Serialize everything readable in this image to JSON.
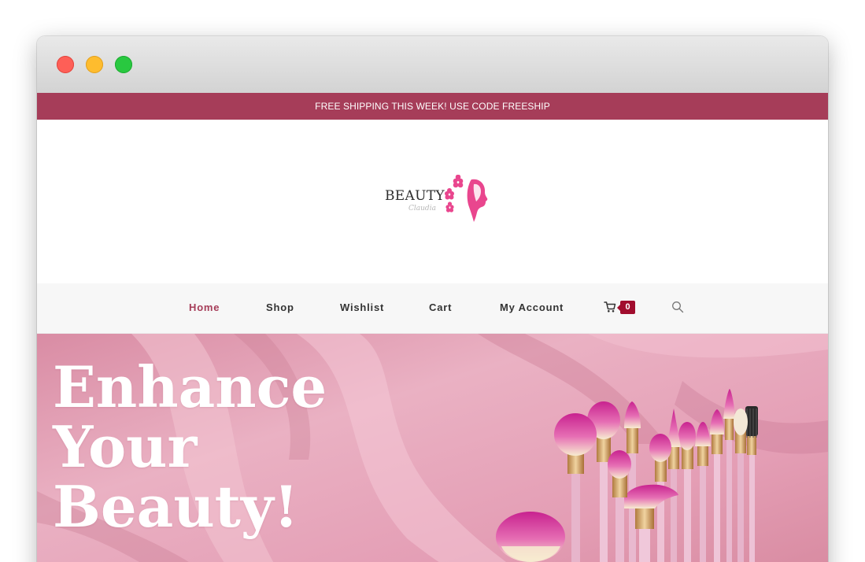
{
  "announcement": {
    "text": "FREE SHIPPING THIS WEEK! USE CODE FREESHIP"
  },
  "logo": {
    "word": "BEAUTY",
    "by": "by",
    "script": "Claudia",
    "icon": "woman-silhouette-with-flowers"
  },
  "nav": {
    "items": [
      {
        "label": "Home",
        "active": true
      },
      {
        "label": "Shop",
        "active": false
      },
      {
        "label": "Wishlist",
        "active": false
      },
      {
        "label": "Cart",
        "active": false
      },
      {
        "label": "My Account",
        "active": false
      }
    ],
    "cart_count": "0",
    "cart_icon": "cart-icon",
    "search_icon": "search-icon"
  },
  "hero": {
    "title_lines": [
      "Enhance",
      "Your",
      "Beauty!"
    ],
    "background": "pink-silk-fabric-with-makeup-brushes"
  },
  "colors": {
    "brand": "#a63d59",
    "badge": "#a10d2e",
    "logo_pink": "#e9468e",
    "hero_pink": "#e7a6bb"
  }
}
